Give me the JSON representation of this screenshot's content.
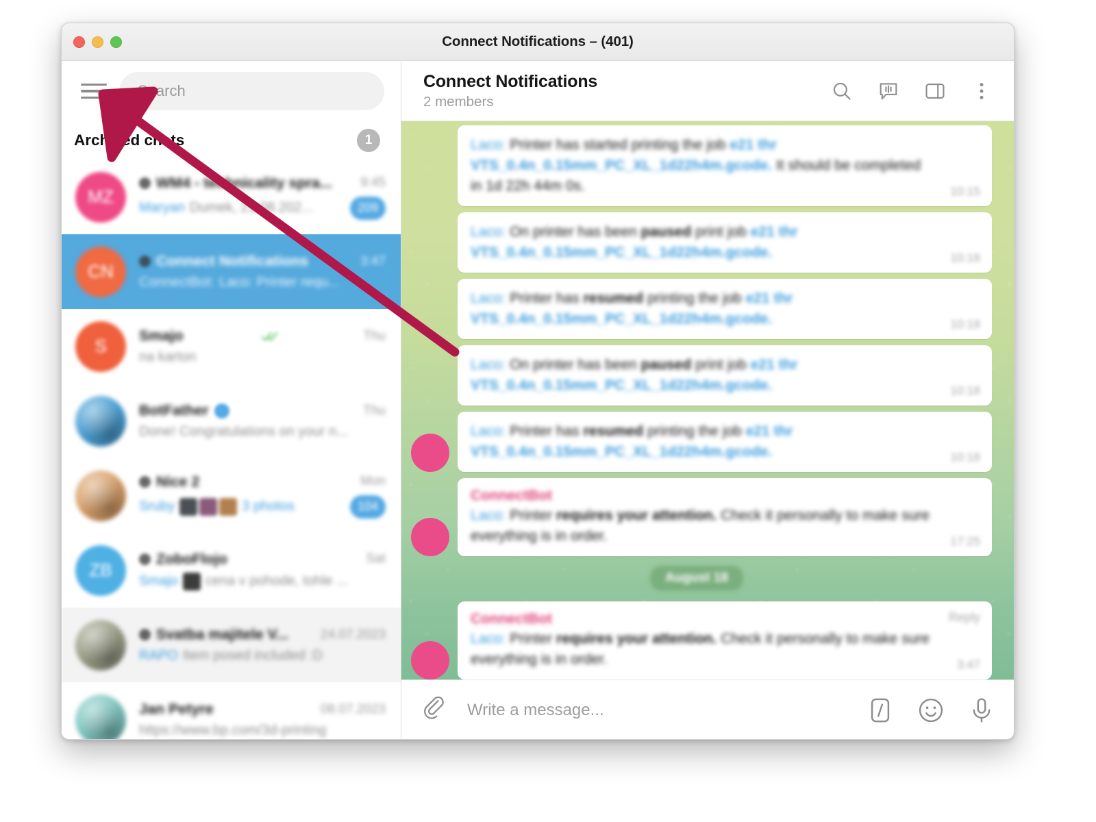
{
  "window": {
    "title": "Connect Notifications – (401)",
    "traffic_lights": [
      "close-button",
      "minimize-button",
      "zoom-button"
    ]
  },
  "sidebar": {
    "menu_icon": "hamburger-menu-icon",
    "search": {
      "placeholder": "Search",
      "value": ""
    },
    "archived": {
      "label": "Archived chats",
      "count": "1"
    },
    "chats": [
      {
        "name": "WM4 - technicality spra...",
        "time": "9:45",
        "sender": "Maryan",
        "preview": "Dumek, 21.08.202...",
        "unread": "209",
        "avatar_text": "MZ",
        "avatar_color": "#ef4a85",
        "group": true,
        "selected": false
      },
      {
        "name": "Connect Notifications",
        "time": "3:47",
        "sender": "ConnectBot:",
        "preview": "Laco: Printer requ...",
        "unread": "",
        "avatar_text": "CN",
        "avatar_color": "#f06a43",
        "group": true,
        "selected": true
      },
      {
        "name": "Smajo",
        "time": "Thu",
        "sender": "",
        "preview": "na karton",
        "unread": "",
        "avatar_text": "S",
        "avatar_color": "#f0603c",
        "group": false,
        "selected": false,
        "sent_check": true
      },
      {
        "name": "BotFather",
        "time": "Thu",
        "sender": "",
        "preview": "Done! Congratulations on your n...",
        "unread": "",
        "avatar_text": "",
        "avatar_color": "#4a9fd4",
        "group": false,
        "verified": true,
        "selected": false
      },
      {
        "name": "Nice 2",
        "time": "Mon",
        "sender": "Sruby",
        "preview": "3 photos",
        "unread": "104",
        "avatar_text": "",
        "avatar_color": "#d8a06a",
        "group": true,
        "photos": true,
        "selected": false
      },
      {
        "name": "ZoboFlojo",
        "time": "Sat",
        "sender": "Smajo",
        "preview": "cena v pohode, tohle ...",
        "unread": "",
        "avatar_text": "ZB",
        "avatar_color": "#4fb0e4",
        "group": true,
        "thumb": true,
        "selected": false
      },
      {
        "name": "Svatba majitele V...",
        "time": "24.07.2023",
        "sender": "RAPO",
        "preview": "Item posed included :D",
        "unread": "",
        "avatar_text": "",
        "avatar_color": "#9a9e87",
        "group": true,
        "selected": false,
        "hovered": true
      },
      {
        "name": "Jan Petyre",
        "time": "08.07.2023",
        "sender": "",
        "preview": "https://www.bp.com/3d-printing",
        "unread": "",
        "avatar_text": "",
        "avatar_color": "#7fc6c0",
        "group": false,
        "selected": false
      }
    ]
  },
  "chat": {
    "title": "Connect Notifications",
    "subtitle": "2 members",
    "actions": [
      "search-icon",
      "voice-chat-icon",
      "side-panel-icon",
      "more-options-icon"
    ],
    "date_divider": "August 18",
    "messages": [
      {
        "id": "m1",
        "title": "",
        "sender": "Laco:",
        "segments": [
          {
            "t": " Printer has started printing the job ",
            "s": "plain"
          },
          {
            "t": "e21 thr VTS_0.4n_0.15mm_PC_XL_1d22h4m.gcode.",
            "s": "link"
          },
          {
            "t": " It should be completed in 1d 22h 44m 0s.",
            "s": "plain"
          }
        ],
        "time": "10:15",
        "avatar": false
      },
      {
        "id": "m2",
        "title": "",
        "sender": "Laco:",
        "segments": [
          {
            "t": " On printer has been ",
            "s": "plain"
          },
          {
            "t": "paused",
            "s": "bold"
          },
          {
            "t": " print job ",
            "s": "plain"
          },
          {
            "t": "e21 thr VTS_0.4n_0.15mm_PC_XL_1d22h4m.gcode.",
            "s": "link"
          }
        ],
        "time": "10:18",
        "avatar": false
      },
      {
        "id": "m3",
        "title": "",
        "sender": "Laco:",
        "segments": [
          {
            "t": " Printer has ",
            "s": "plain"
          },
          {
            "t": "resumed",
            "s": "bold"
          },
          {
            "t": " printing the job ",
            "s": "plain"
          },
          {
            "t": "e21 thr VTS_0.4n_0.15mm_PC_XL_1d22h4m.gcode.",
            "s": "link"
          }
        ],
        "time": "10:18",
        "avatar": false
      },
      {
        "id": "m4",
        "title": "",
        "sender": "Laco:",
        "segments": [
          {
            "t": " On printer has been ",
            "s": "plain"
          },
          {
            "t": "paused",
            "s": "bold"
          },
          {
            "t": " print job ",
            "s": "plain"
          },
          {
            "t": "e21 thr VTS_0.4n_0.15mm_PC_XL_1d22h4m.gcode.",
            "s": "link"
          }
        ],
        "time": "10:18",
        "avatar": false
      },
      {
        "id": "m5",
        "title": "",
        "sender": "Laco:",
        "segments": [
          {
            "t": " Printer has ",
            "s": "plain"
          },
          {
            "t": "resumed",
            "s": "bold"
          },
          {
            "t": " printing the job ",
            "s": "plain"
          },
          {
            "t": "e21 thr VTS_0.4n_0.15mm_PC_XL_1d22h4m.gcode.",
            "s": "link"
          }
        ],
        "time": "10:18",
        "avatar": true
      },
      {
        "id": "m6",
        "title": "ConnectBot",
        "sender": "Laco:",
        "segments": [
          {
            "t": " Printer ",
            "s": "plain"
          },
          {
            "t": "requires your attention.",
            "s": "bold"
          },
          {
            "t": " Check it personally to make sure everything is in order.",
            "s": "plain"
          }
        ],
        "time": "17:25",
        "avatar": true
      },
      {
        "id": "m7",
        "title": "ConnectBot",
        "sender": "Laco:",
        "segments": [
          {
            "t": " Printer ",
            "s": "plain"
          },
          {
            "t": "requires your attention.",
            "s": "bold"
          },
          {
            "t": " Check it personally to make sure everything is in order.",
            "s": "plain"
          }
        ],
        "time": "3:47",
        "reply_label": "Reply",
        "avatar": true
      }
    ]
  },
  "composer": {
    "attach_icon": "paperclip-icon",
    "placeholder": "Write a message...",
    "value": "",
    "actions": [
      "slash-command-icon",
      "emoji-icon",
      "microphone-icon"
    ]
  },
  "annotation": {
    "arrow_color": "#b0184a",
    "points_to": "hamburger-menu-icon"
  }
}
